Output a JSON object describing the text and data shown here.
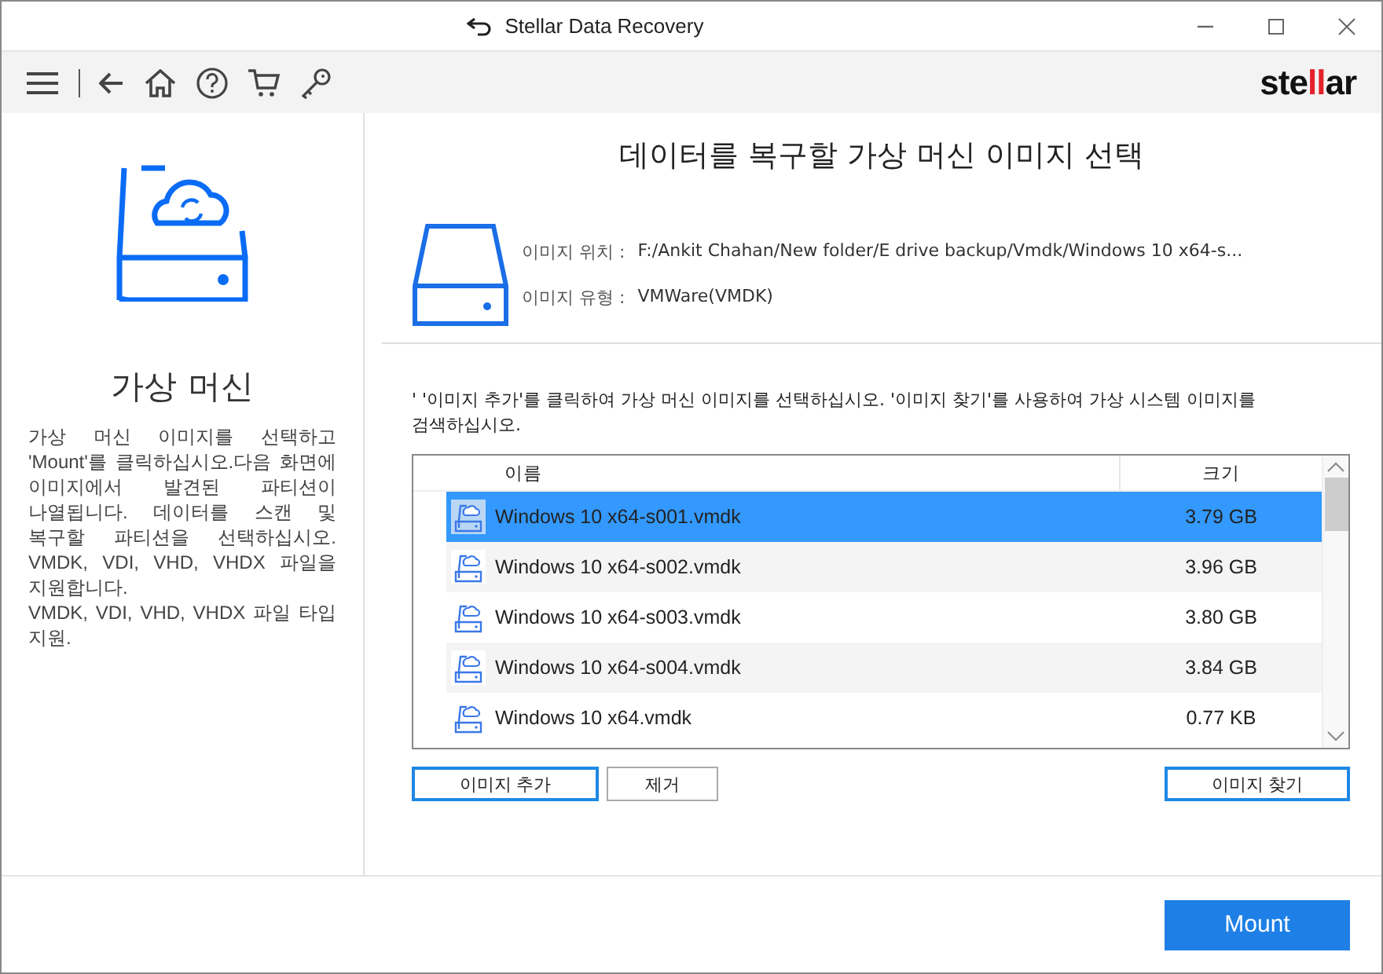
{
  "window": {
    "title": "Stellar Data Recovery"
  },
  "logo": {
    "before": "ste",
    "accent": "ll",
    "after": "ar"
  },
  "sidebar": {
    "title": "가상 머신",
    "description": "가상 머신 이미지를 선택하고 'Mount'를 클릭하십시오.다음 화면에 이미지에서 발견된 파티션이 나열됩니다. 데이터를 스캔 및 복구할 파티션을 선택하십시오. VMDK, VDI, VHD, VHDX 파일을 지원합니다.",
    "note": "VMDK, VDI, VHD, VHDX 파일 타입 지원."
  },
  "main": {
    "heading": "데이터를 복구할 가상 머신 이미지 선택",
    "info": [
      {
        "label": "이미지 위치 :",
        "value": "F:/Ankit Chahan/New folder/E drive backup/Vmdk/Windows 10 x64-s..."
      },
      {
        "label": "이미지 유형 :",
        "value": "VMWare(VMDK)"
      }
    ],
    "instruction": "' '이미지 추가'를 클릭하여 가상 머신 이미지를 선택하십시오. '이미지 찾기'를 사용하여 가상 시스템 이미지를 검색하십시오."
  },
  "table": {
    "columns": [
      "이름",
      "크기"
    ],
    "rows": [
      {
        "name": "Windows 10 x64-s001.vmdk",
        "size": "3.79 GB",
        "selected": true
      },
      {
        "name": "Windows 10 x64-s002.vmdk",
        "size": "3.96 GB",
        "selected": false
      },
      {
        "name": "Windows 10 x64-s003.vmdk",
        "size": "3.80 GB",
        "selected": false
      },
      {
        "name": "Windows 10 x64-s004.vmdk",
        "size": "3.84 GB",
        "selected": false
      },
      {
        "name": "Windows 10 x64.vmdk",
        "size": "0.77 KB",
        "selected": false
      }
    ]
  },
  "buttons": {
    "add": "이미지 추가",
    "remove": "제거",
    "find": "이미지 찾기",
    "mount": "Mount"
  }
}
